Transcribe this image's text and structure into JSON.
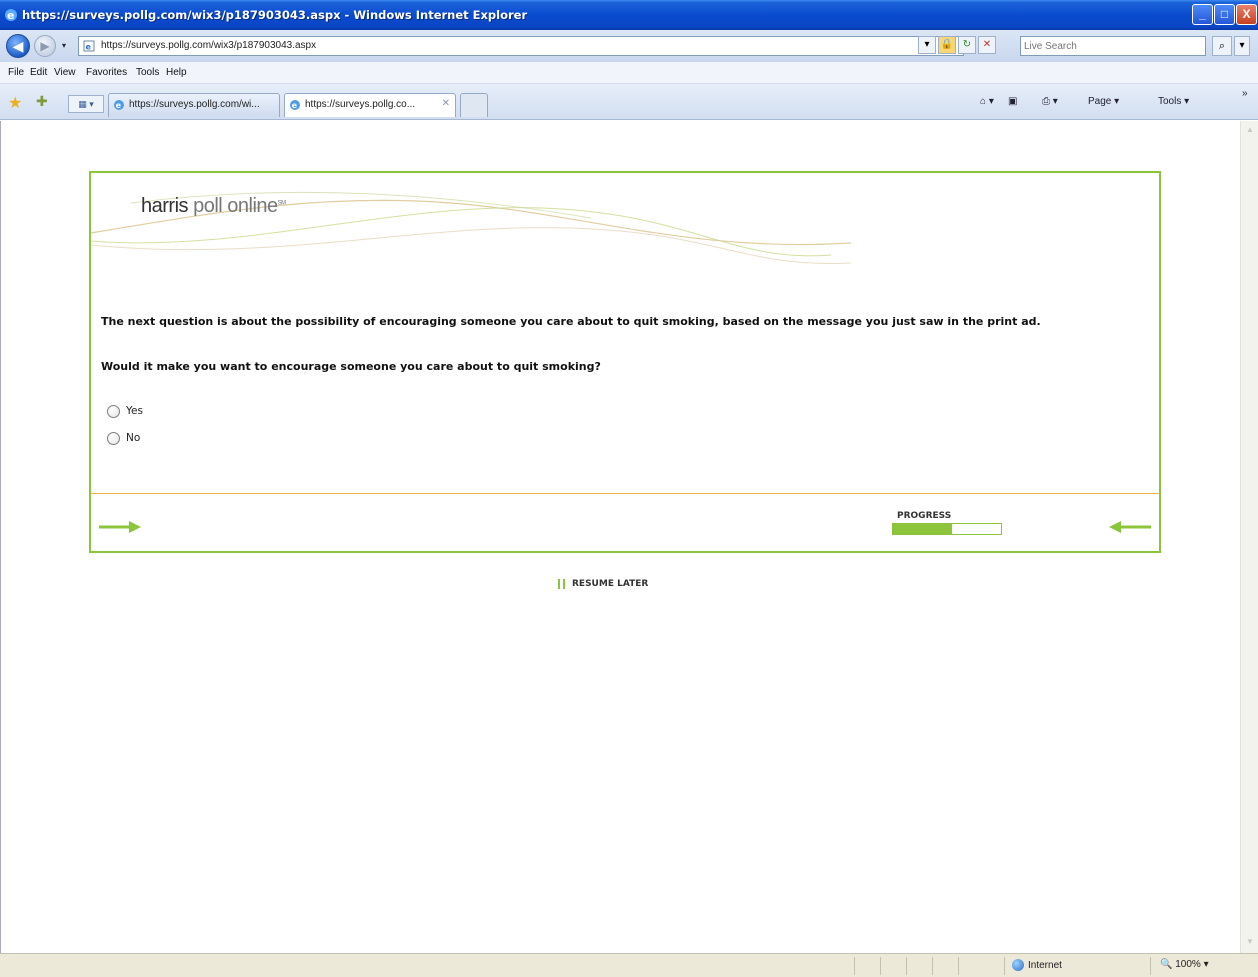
{
  "window": {
    "title": "https://surveys.pollg.com/wix3/p187903043.aspx - Windows Internet Explorer",
    "min_label": "_",
    "max_label": "□",
    "close_label": "X"
  },
  "address": {
    "url": "https://surveys.pollg.com/wix3/p187903043.aspx",
    "search_placeholder": "Live Search",
    "back_glyph": "◀",
    "forward_glyph": "▶",
    "recent_glyph": "▾",
    "search_glyph": "⌕",
    "search_options_glyph": "▾"
  },
  "menu": {
    "file": "File",
    "edit": "Edit",
    "view": "View",
    "favorites": "Favorites",
    "tools": "Tools",
    "help": "Help"
  },
  "tabs": {
    "quick_tabs_label": "▦ ▾",
    "tab1": "https://surveys.pollg.com/wi...",
    "tab2": "https://surveys.pollg.co...",
    "close_glyph": "✕"
  },
  "command_bar": {
    "home": "⌂ ▾",
    "feeds": "▣",
    "print": "⎙ ▾",
    "page": "Page ▾",
    "tools": "Tools ▾",
    "more": "»"
  },
  "survey": {
    "logo_main": "harris",
    "logo_light": " poll online",
    "logo_tm": "SM",
    "question_intro": "The next question is about the possibility of encouraging someone you care about to quit smoking, based on the message you just saw in the print ad.",
    "question": "Would it make you want to encourage someone you care about to quit smoking?",
    "options": [
      "Yes",
      "No"
    ],
    "progress_label": "PROGRESS",
    "progress_fraction": 0.55,
    "resume_label": "RESUME LATER"
  },
  "status": {
    "zone": "Internet",
    "zoom": "100%"
  },
  "colors": {
    "accent_green": "#8cc43c",
    "divider_orange": "#f0b34a",
    "titlebar_blue": "#0a4bd0"
  }
}
